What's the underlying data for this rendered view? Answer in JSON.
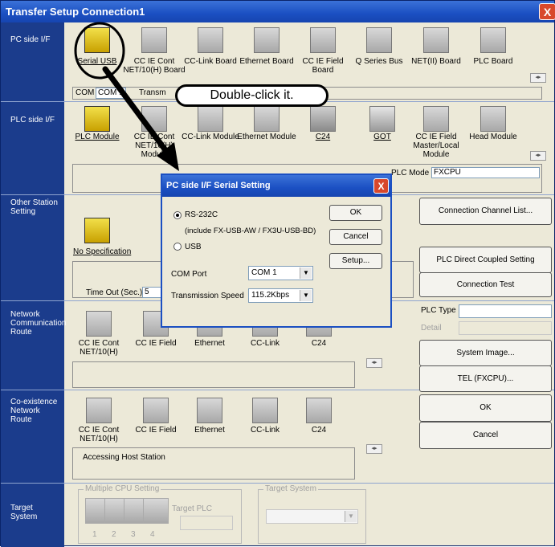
{
  "window": {
    "title": "Transfer Setup Connection1",
    "close": "X"
  },
  "sections": {
    "pc_side": "PC side I/F",
    "plc_side": "PLC side I/F",
    "other_station": "Other Station Setting",
    "network_route": "Network Communication Route",
    "coexistence_route": "Co-existence Network Route",
    "target_system": "Target System"
  },
  "pc_side_items": [
    "Serial USB",
    "CC IE Cont NET/10(H) Board",
    "CC-Link Board",
    "Ethernet Board",
    "CC IE Field Board",
    "Q Series Bus",
    "NET(II) Board",
    "PLC Board"
  ],
  "pc_status": {
    "com_label": "COM",
    "com_value": "COM 1",
    "transm": "Transm"
  },
  "plc_side_items": [
    "PLC Module",
    "CC IE Cont NET/10(H) Module",
    "CC-Link Module",
    "Ethernet Module",
    "C24",
    "GOT",
    "CC IE Field Master/Local Module",
    "Head Module"
  ],
  "plc_mode": {
    "label": "PLC Mode",
    "value": "FXCPU"
  },
  "other_station": {
    "label": "No Specification",
    "timeout_label": "Time Out (Sec.)",
    "timeout_value": "5"
  },
  "network_items": [
    "CC IE Cont NET/10(H)",
    "CC IE Field",
    "Ethernet",
    "CC-Link",
    "C24"
  ],
  "coexistence_items": [
    "CC IE Cont NET/10(H)",
    "CC IE Field",
    "Ethernet",
    "CC-Link",
    "C24"
  ],
  "accessing_host": "Accessing Host Station",
  "target": {
    "multiple_cpu": "Multiple CPU Setting",
    "target_plc": "Target PLC",
    "target_system": "Target System",
    "cpu_numbers": [
      "1",
      "2",
      "3",
      "4"
    ]
  },
  "right_buttons": {
    "channel_list": "Connection Channel List...",
    "direct_coupled": "PLC Direct Coupled Setting",
    "connection_test": "Connection Test",
    "plc_type": "PLC Type",
    "detail": "Detail",
    "system_image": "System Image...",
    "tel": "TEL (FXCPU)...",
    "ok": "OK",
    "cancel": "Cancel"
  },
  "callout": "Double-click it.",
  "dialog": {
    "title": "PC side I/F Serial Setting",
    "close": "X",
    "rs232c": "RS-232C",
    "include_note": "(include FX-USB-AW / FX3U-USB-BD)",
    "usb": "USB",
    "com_port_label": "COM Port",
    "com_port_value": "COM 1",
    "speed_label": "Transmission Speed",
    "speed_value": "115.2Kbps",
    "ok": "OK",
    "cancel": "Cancel",
    "setup": "Setup...",
    "selected": "RS-232C"
  }
}
